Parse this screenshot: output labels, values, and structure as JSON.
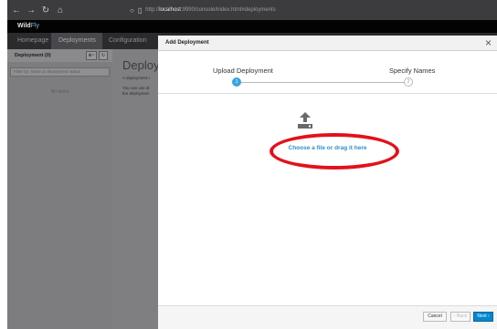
{
  "browser": {
    "url_prefix": "http://",
    "url_host": "localhost",
    "url_rest": ":9990/console/index.html#deployments"
  },
  "app": {
    "brand_main": "Wild",
    "brand_accent": "Fly"
  },
  "nav": {
    "homepage": "Homepage",
    "deployments": "Deployments",
    "configuration": "Configuration"
  },
  "left_pane": {
    "title": "Deployment (0)",
    "add_button": "⊕~",
    "refresh_button": "↻",
    "filter_placeholder": "Filter by: name or deployment status",
    "empty_text": "No items"
  },
  "center": {
    "title": "Deploym",
    "p1": "A deployment r",
    "p2": "You can use dr",
    "p3": "the deploymen"
  },
  "modal": {
    "title": "Add Deployment",
    "close_label": "×",
    "steps": [
      {
        "label": "Upload Deployment",
        "number": "1"
      },
      {
        "label": "Specify Names",
        "number": "2"
      }
    ],
    "upload_text": "Choose a file or drag it here",
    "footer": {
      "cancel_label": "Cancel",
      "back_label": "‹ Back",
      "next_label": "Next ›"
    }
  },
  "colors": {
    "accent": "#0088ce",
    "link": "#2d8fc9",
    "step_active": "#39a5dc",
    "annotation": "#e3111a"
  }
}
